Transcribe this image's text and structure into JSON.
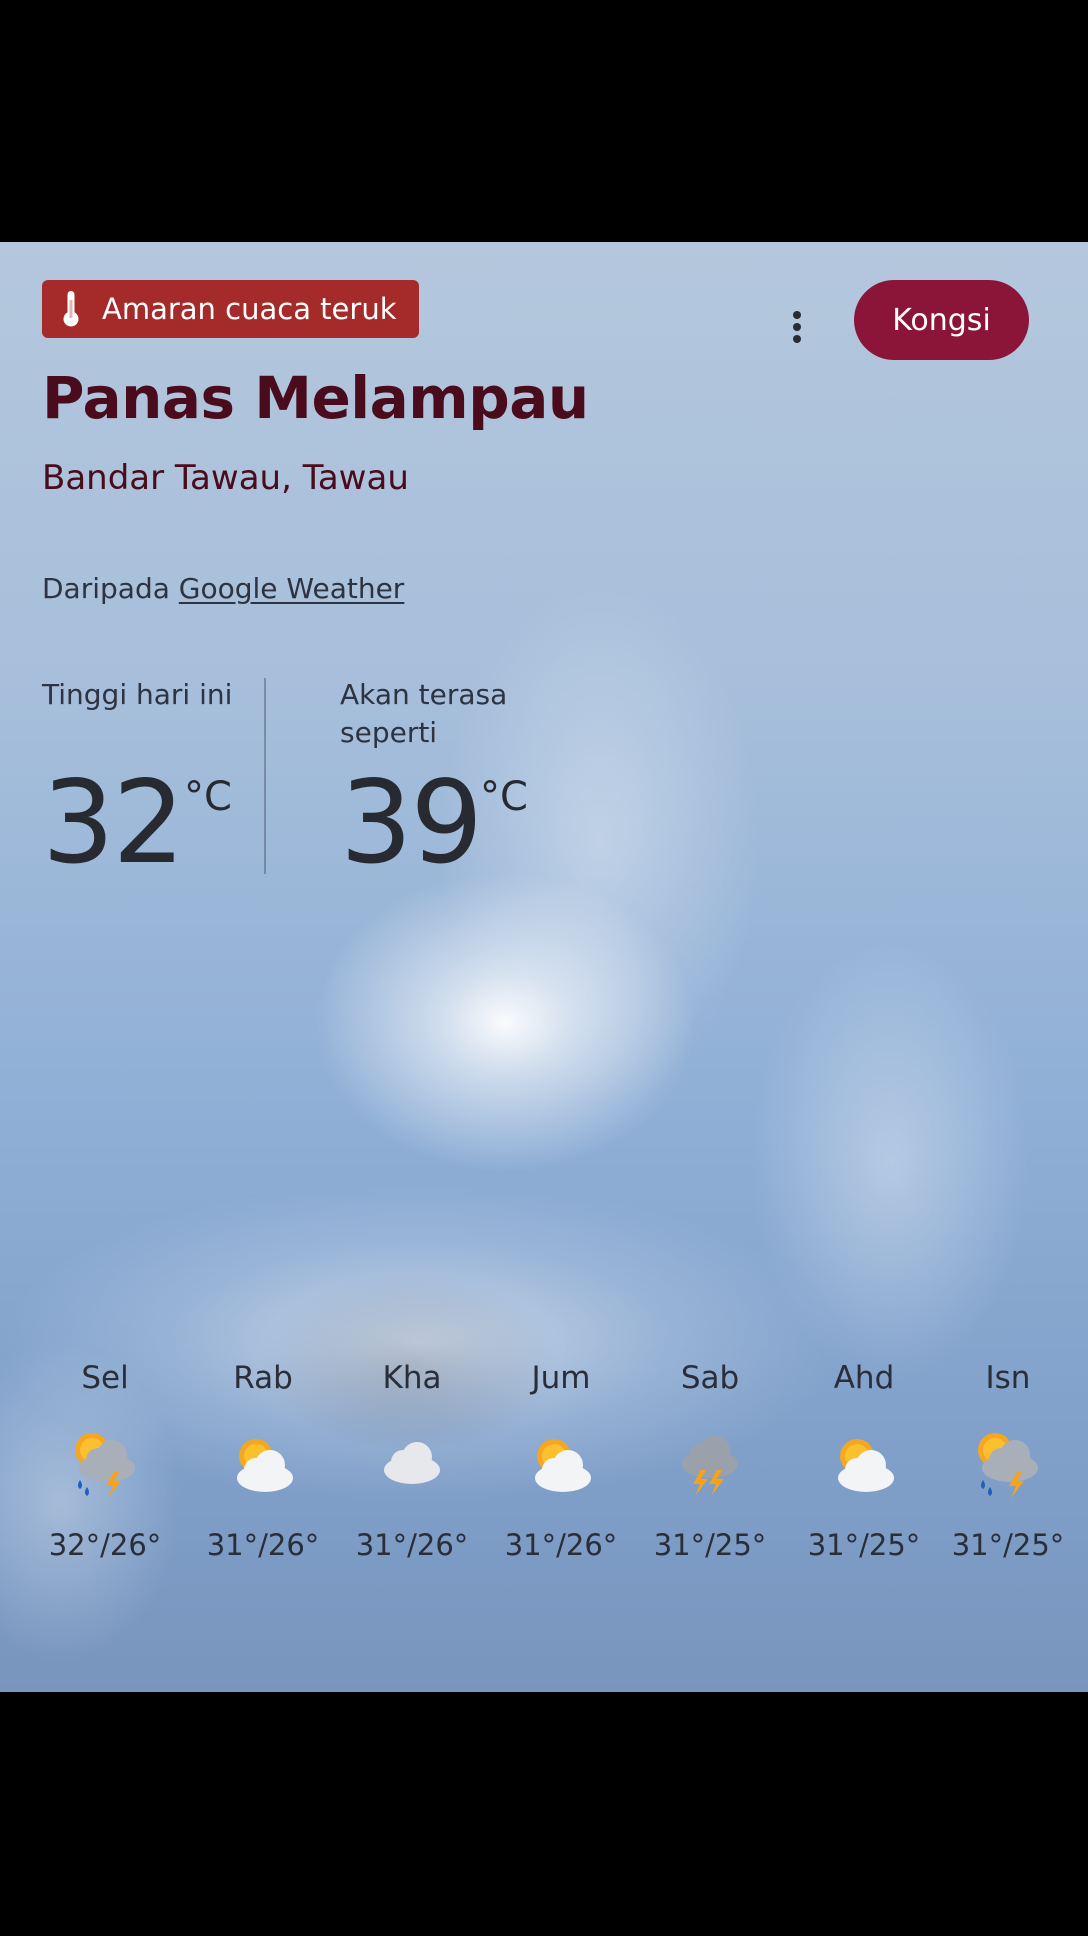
{
  "alert": {
    "label": "Amaran cuaca teruk",
    "icon": "thermometer-icon",
    "color": "#a52b2b"
  },
  "share": {
    "label": "Kongsi",
    "color": "#8a1538"
  },
  "menu": {
    "icon": "more-vertical-icon"
  },
  "header": {
    "title": "Panas Melampau",
    "location": "Bandar Tawau, Tawau"
  },
  "source": {
    "prefix": "Daripada",
    "link": "Google Weather"
  },
  "stats": {
    "high": {
      "label": "Tinggi hari ini",
      "value": "32",
      "unit": "°C"
    },
    "feels_like": {
      "label": "Akan terasa seperti",
      "value": "39",
      "unit": "°C"
    }
  },
  "forecast": [
    {
      "day": "Sel",
      "icon": "thunderstorm-rain-icon",
      "temp": "32°/26°"
    },
    {
      "day": "Rab",
      "icon": "partly-cloudy-icon",
      "temp": "31°/26°"
    },
    {
      "day": "Kha",
      "icon": "cloudy-icon",
      "temp": "31°/26°"
    },
    {
      "day": "Jum",
      "icon": "partly-cloudy-icon",
      "temp": "31°/26°"
    },
    {
      "day": "Sab",
      "icon": "thunderstorm-icon",
      "temp": "31°/25°"
    },
    {
      "day": "Ahd",
      "icon": "partly-cloudy-icon",
      "temp": "31°/25°"
    },
    {
      "day": "Isn",
      "icon": "thunderstorm-rain-icon",
      "temp": "31°/25°"
    }
  ]
}
